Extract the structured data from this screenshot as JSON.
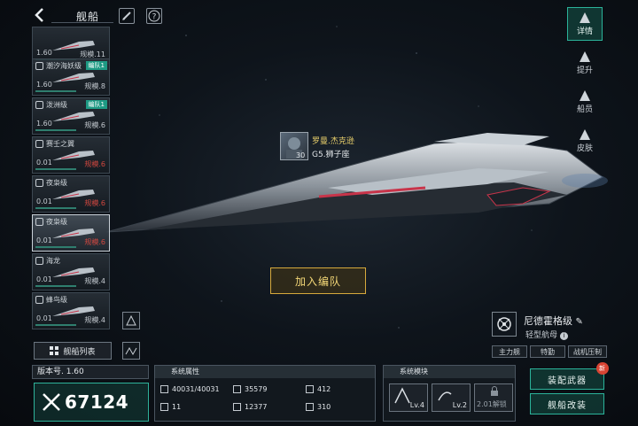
{
  "header": {
    "title": "舰船",
    "icons": [
      "back-icon",
      "edit-icon",
      "help-icon"
    ]
  },
  "ship_list": [
    {
      "class": "",
      "version": "1.60",
      "size": "规模.11",
      "badge": "",
      "size_red": false
    },
    {
      "class": "潮汐海妖级",
      "version": "1.60",
      "size": "规模.8",
      "badge": "编队1",
      "size_red": false
    },
    {
      "class": "泼洲级",
      "version": "1.60",
      "size": "规模.6",
      "badge": "编队1",
      "size_red": false
    },
    {
      "class": "赛壬之翼",
      "version": "0.01",
      "size": "规模.6",
      "badge": "",
      "size_red": true
    },
    {
      "class": "夜枭级",
      "version": "0.01",
      "size": "规模.6",
      "badge": "",
      "size_red": true
    },
    {
      "class": "夜枭级",
      "version": "0.01",
      "size": "规模.6",
      "badge": "",
      "size_red": true
    },
    {
      "class": "海龙",
      "version": "0.01",
      "size": "规模.4",
      "badge": "",
      "size_red": false
    },
    {
      "class": "蜂鸟级",
      "version": "0.01",
      "size": "规模.4",
      "badge": "",
      "size_red": false
    }
  ],
  "list_button": "舰船列表",
  "right_tabs": [
    {
      "label": "详情",
      "icon": "details-icon",
      "active": true
    },
    {
      "label": "提升",
      "icon": "upgrade-icon",
      "active": false
    },
    {
      "label": "船员",
      "icon": "crew-icon",
      "active": false
    },
    {
      "label": "皮肤",
      "icon": "skin-icon",
      "active": false
    }
  ],
  "pilot": {
    "name": "罗曼.杰克逊",
    "rank": "G5.狮子座",
    "level": "30"
  },
  "join_fleet": "加入编队",
  "ship": {
    "name": "尼德霍格级",
    "type": "轻型航母",
    "tags": [
      "主力舰",
      "特勤",
      "战机压制"
    ]
  },
  "version": "版本号. 1.60",
  "power": "67124",
  "attributes": {
    "title": "系统属性",
    "stats": [
      {
        "icon": "hull-icon",
        "value": "40031/40031"
      },
      {
        "icon": "armor-icon",
        "value": "35579"
      },
      {
        "icon": "shield-icon",
        "value": "412"
      },
      {
        "icon": "evasion-icon",
        "value": "11"
      },
      {
        "icon": "target-icon",
        "value": "12377"
      },
      {
        "icon": "speed-icon",
        "value": "310"
      }
    ]
  },
  "modules": {
    "title": "系统模块",
    "items": [
      {
        "icon": "module-a-icon",
        "label": "Lv.4"
      },
      {
        "icon": "module-b-icon",
        "label": "Lv.2"
      },
      {
        "icon": "lock-icon",
        "label": "2.01解锁"
      }
    ]
  },
  "actions": {
    "equip": "装配武器",
    "refit": "舰船改装",
    "new_badge": "新"
  },
  "colors": {
    "accent": "#2bb39a",
    "gold": "#d6a93c",
    "alert": "#d2473f"
  }
}
